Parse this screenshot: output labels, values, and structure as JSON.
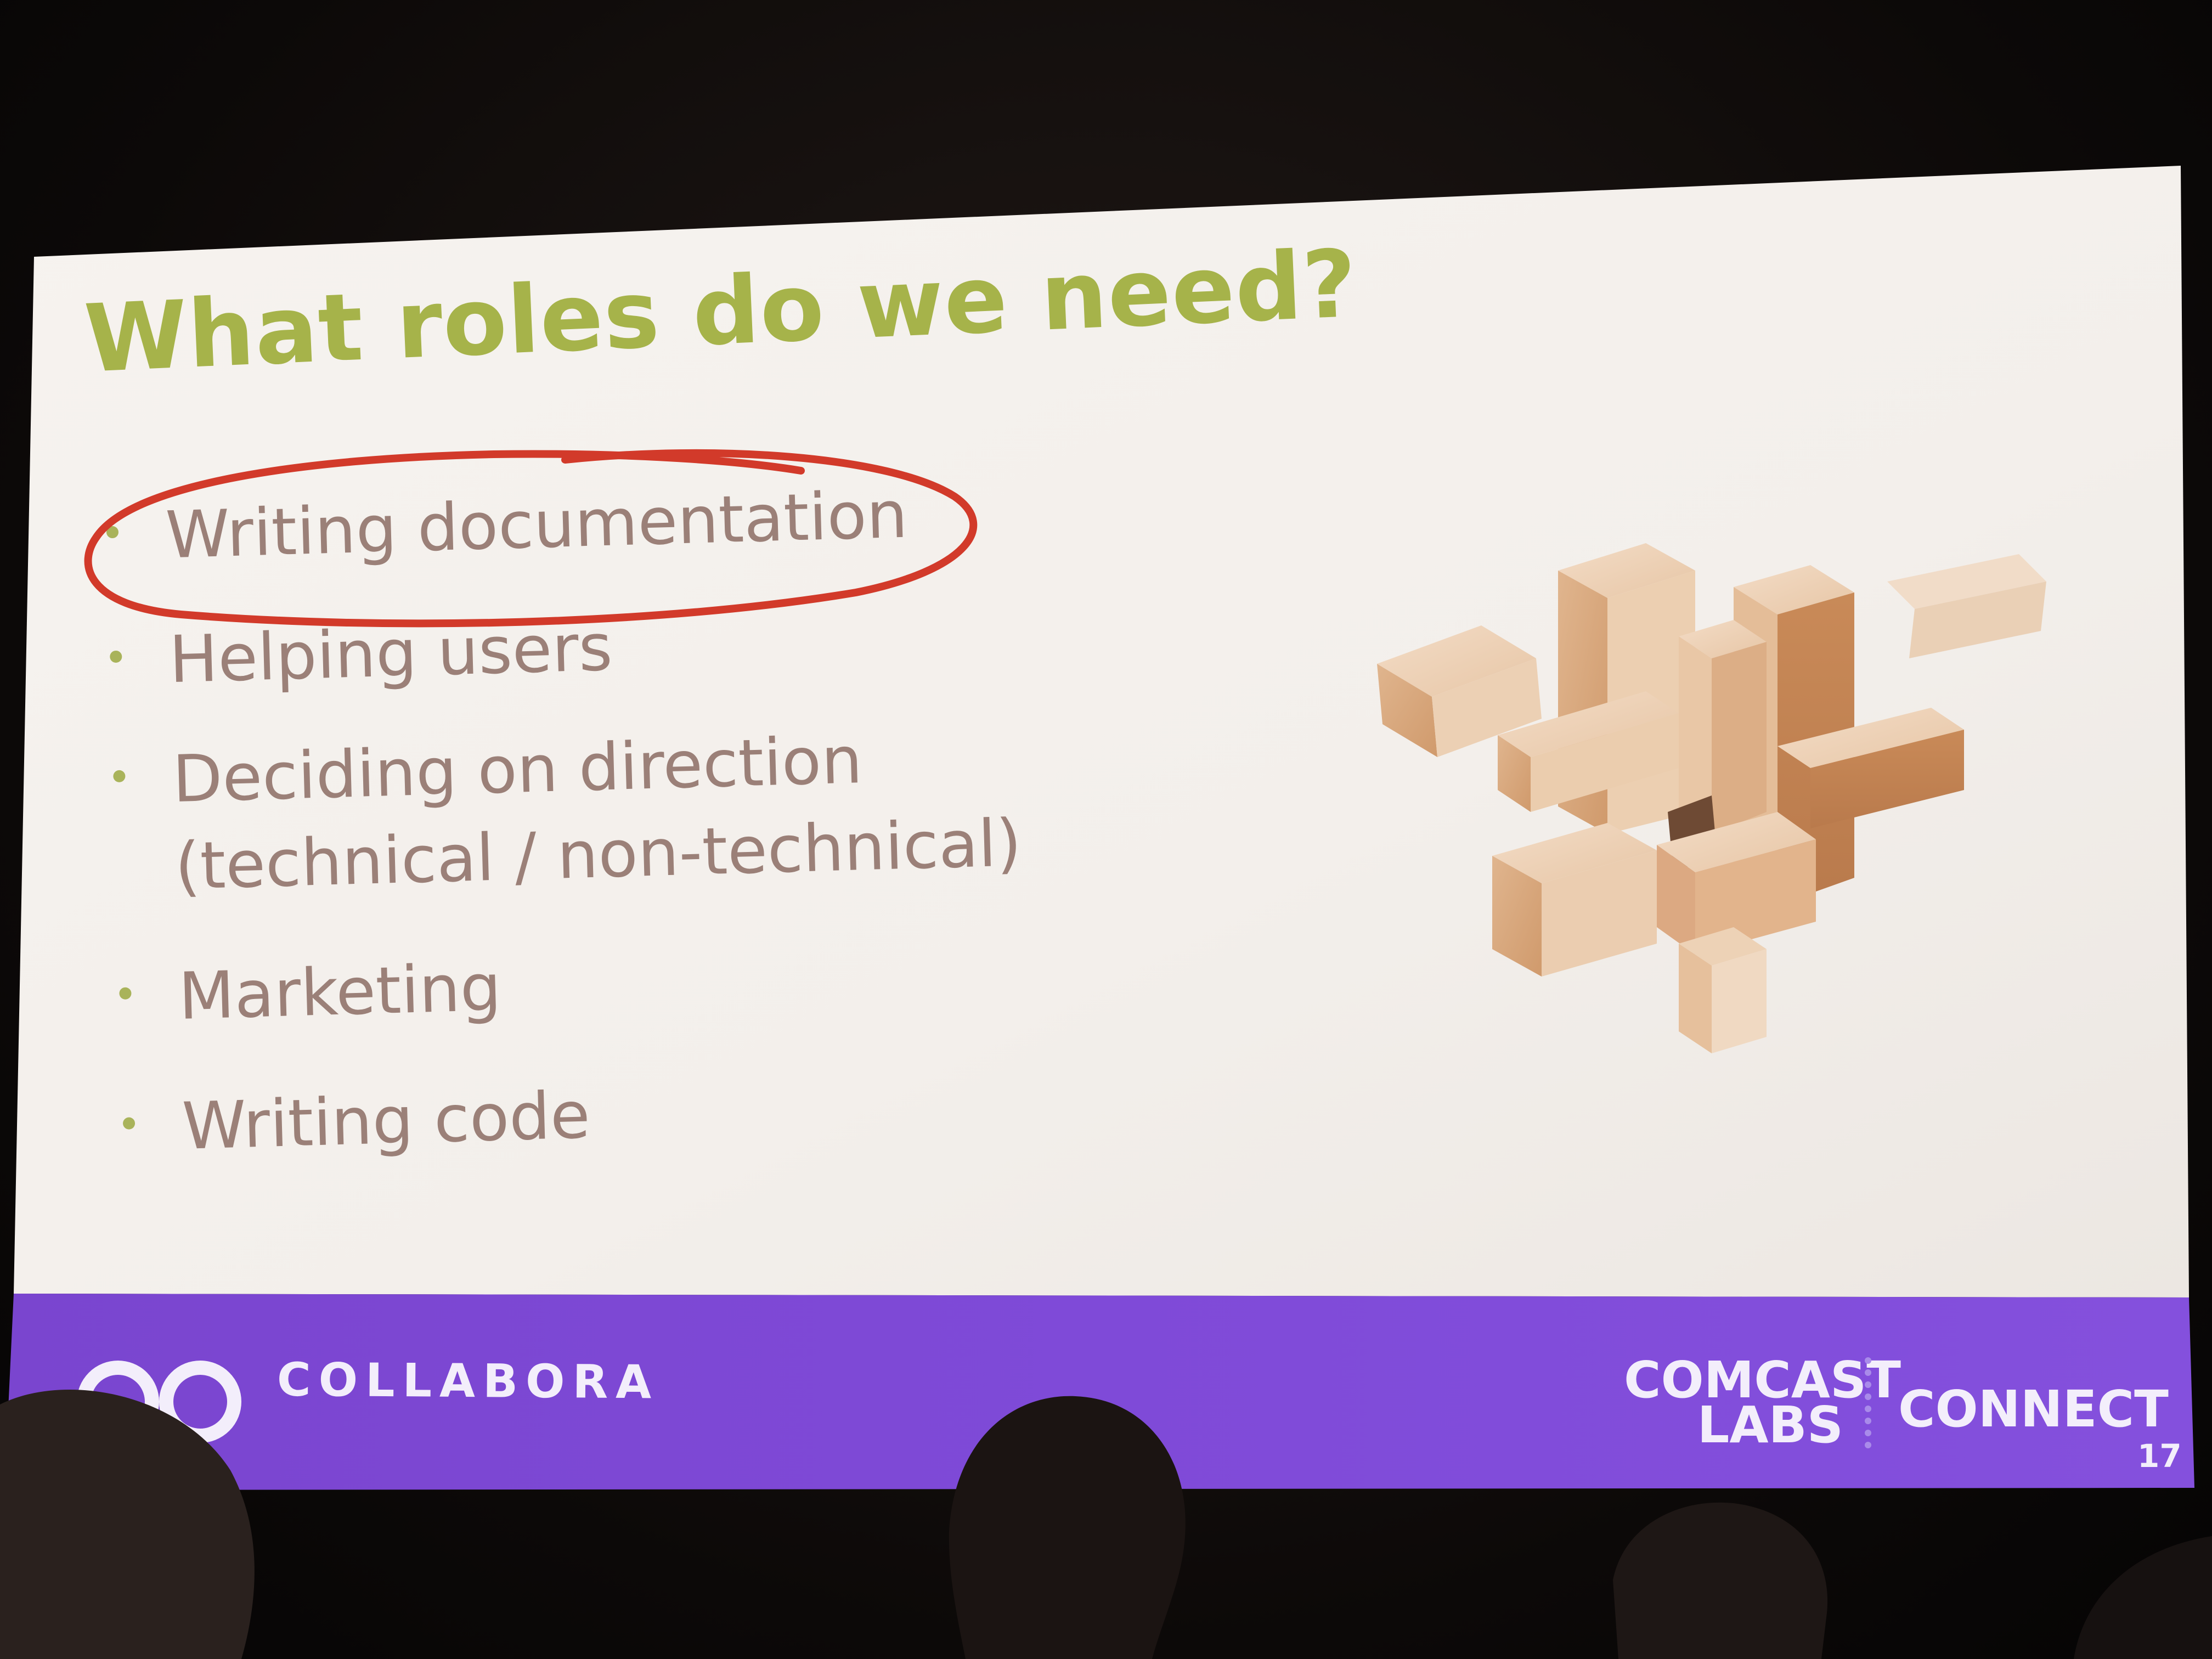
{
  "slide": {
    "title": "What roles do we need?",
    "bullets": [
      {
        "text": "Writing documentation",
        "circled": true
      },
      {
        "text": "Helping users",
        "circled": false
      },
      {
        "text": "Deciding on direction",
        "text2": "(technical / non-technical)",
        "circled": false
      },
      {
        "text": "Marketing",
        "circled": false
      },
      {
        "text": "Writing code",
        "circled": false
      }
    ],
    "image": "wooden-burr-puzzle",
    "footer": {
      "logo_left": "COLLABORA",
      "logo_right_line1": "COMCAST",
      "logo_right_line2": "LABS",
      "logo_right_connect": "CONNECT",
      "page_number": "17"
    }
  },
  "colors": {
    "title": "#a6b34a",
    "bullet_text": "#9b8078",
    "bullet_dot": "#a9b35a",
    "footer": "#7b45d6",
    "annotation": "#d23a2a",
    "slide_background": "#f4f1ee"
  }
}
